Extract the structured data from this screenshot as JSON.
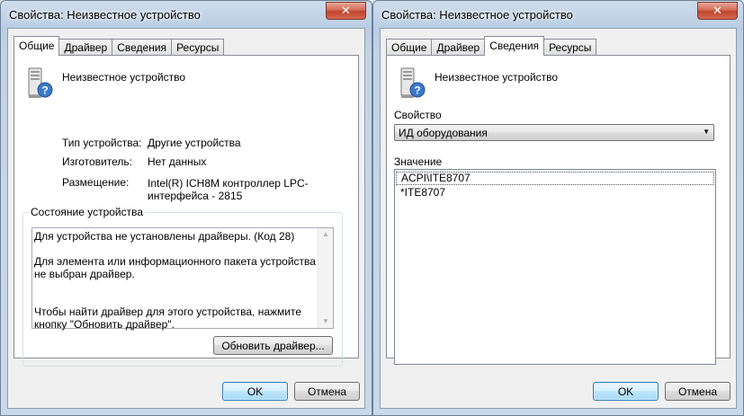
{
  "left_window": {
    "title": "Свойства: Неизвестное устройство",
    "close_glyph": "✕",
    "tabs": [
      {
        "label": "Общие",
        "active": true
      },
      {
        "label": "Драйвер",
        "active": false
      },
      {
        "label": "Сведения",
        "active": false
      },
      {
        "label": "Ресурсы",
        "active": false
      }
    ],
    "device_name": "Неизвестное устройство",
    "device_icon": "unknown-device-icon",
    "properties": [
      {
        "label": "Тип устройства:",
        "value": "Другие устройства"
      },
      {
        "label": "Изготовитель:",
        "value": "Нет данных"
      },
      {
        "label": "Размещение:",
        "value": "Intel(R) ICH8M контроллер LPC-интерфейса - 2815"
      }
    ],
    "status_group": {
      "legend": "Состояние устройства",
      "paragraphs": [
        "Для устройства не установлены драйверы. (Код 28)",
        "Для элемента или информационного пакета устройства не выбран драйвер.",
        "Чтобы найти драйвер для этого устройства, нажмите кнопку \"Обновить драйвер\"."
      ],
      "update_button": "Обновить драйвер..."
    },
    "ok_button": "OK",
    "cancel_button": "Отмена"
  },
  "right_window": {
    "title": "Свойства: Неизвестное устройство",
    "close_glyph": "✕",
    "tabs": [
      {
        "label": "Общие",
        "active": false
      },
      {
        "label": "Драйвер",
        "active": false
      },
      {
        "label": "Сведения",
        "active": true
      },
      {
        "label": "Ресурсы",
        "active": false
      }
    ],
    "device_name": "Неизвестное устройство",
    "property_label": "Свойство",
    "property_selected": "ИД оборудования",
    "value_label": "Значение",
    "values": [
      "ACPI\\ITE8707",
      "*ITE8707"
    ],
    "ok_button": "OK",
    "cancel_button": "Отмена"
  },
  "colors": {
    "titlebar": "#c3d4e8",
    "close_button": "#c0432b",
    "default_button": "#bee6fd"
  }
}
